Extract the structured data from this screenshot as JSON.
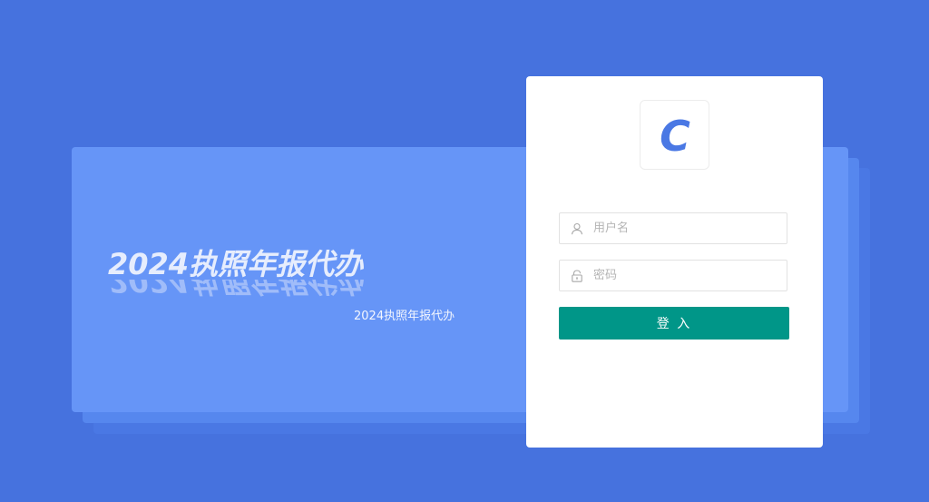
{
  "banner": {
    "title": "2024执照年报代办",
    "subtitle": "2024执照年报代办"
  },
  "login": {
    "logo_letter": "C",
    "username_placeholder": "用户名",
    "password_placeholder": "密码",
    "submit_label": "登 入",
    "username_icon": "user-icon",
    "password_icon": "lock-icon"
  },
  "colors": {
    "page_background": "#4672de",
    "banner": "#6695f7",
    "logo": "#4a78e4",
    "button": "#009688"
  }
}
